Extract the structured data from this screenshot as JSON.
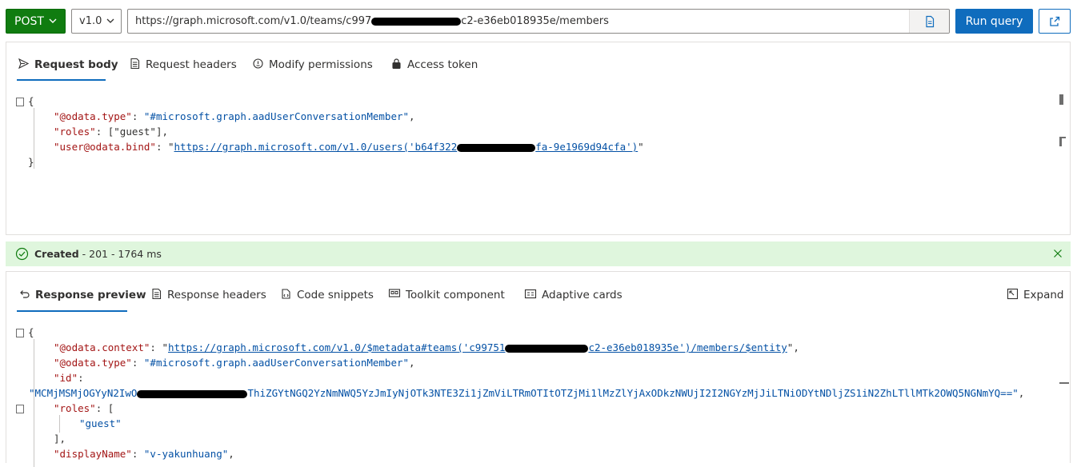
{
  "toolbar": {
    "method": "POST",
    "version": "v1.0",
    "url_prefix": "https://graph.microsoft.com/v1.0/teams/c997",
    "url_suffix": "c2-e36eb018935e/members",
    "run_label": "Run query"
  },
  "request": {
    "tabs": [
      {
        "label": "Request body",
        "icon": "send-icon"
      },
      {
        "label": "Request headers",
        "icon": "headers-icon"
      },
      {
        "label": "Modify permissions",
        "icon": "shield-icon"
      },
      {
        "label": "Access token",
        "icon": "lock-icon"
      }
    ],
    "body": {
      "k1": "\"@odata.type\"",
      "v1": "\"#microsoft.graph.aadUserConversationMember\"",
      "k2": "\"roles\"",
      "v2": "[\"guest\"]",
      "k3": "\"user@odata.bind\"",
      "v3_prefix": "https://graph.microsoft.com/v1.0/users('b64f322",
      "v3_suffix": "fa-9e1969d94cfa')"
    }
  },
  "status": {
    "label": "Created",
    "detail": " - 201 - 1764 ms",
    "color": "#dff6dd"
  },
  "response": {
    "tabs": [
      {
        "label": "Response preview",
        "icon": "undo-arrow-icon"
      },
      {
        "label": "Response headers",
        "icon": "headers-icon"
      },
      {
        "label": "Code snippets",
        "icon": "code-snippet-icon"
      },
      {
        "label": "Toolkit component",
        "icon": "toolkit-icon"
      },
      {
        "label": "Adaptive cards",
        "icon": "card-icon"
      }
    ],
    "expand_label": "Expand",
    "body": {
      "k_context": "\"@odata.context\"",
      "v_context_prefix": "https://graph.microsoft.com/v1.0/$metadata#teams('c99751",
      "v_context_suffix": "c2-e36eb018935e')/members/$entity",
      "k_type": "\"@odata.type\"",
      "v_type": "\"#microsoft.graph.aadUserConversationMember\"",
      "k_id": "\"id\"",
      "v_id_prefix": "\"MCMjMSMjOGYyN2IwO",
      "v_id_suffix": "ThiZGYtNGQ2YzNmNWQ5YzJmIyNjOTk3NTE3Zi1jZmViLTRmOTItOTZjMi1lMzZlYjAxODkzNWUjI2I2NGYzMjJiLTNiODYtNDljZS1iN2ZhLTllMTk2OWQ5NGNmYQ==\"",
      "k_roles": "\"roles\"",
      "v_role": "\"guest\"",
      "k_display": "\"displayName\"",
      "v_display": "\"v-yakunhuang\""
    }
  },
  "colors": {
    "accent": "#0f6cbd",
    "method_green": "#107c10",
    "json_key": "#a31515",
    "json_string": "#0451a5"
  }
}
